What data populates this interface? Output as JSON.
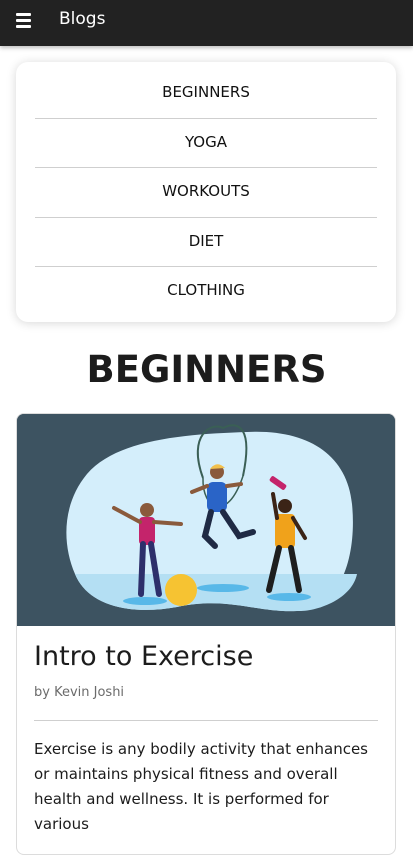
{
  "topbar": {
    "title": "Blogs",
    "menu_icon": "hamburger-menu-icon"
  },
  "categories": [
    {
      "label": "BEGINNERS"
    },
    {
      "label": "YOGA"
    },
    {
      "label": "WORKOUTS"
    },
    {
      "label": "DIET"
    },
    {
      "label": "CLOTHING"
    }
  ],
  "section": {
    "heading": "BEGINNERS"
  },
  "post": {
    "title": "Intro to Exercise",
    "author": "by Kevin Joshi",
    "excerpt": "Exercise is any bodily activity that enhances or maintains physical fitness and overall health and wellness. It is performed for various",
    "image_icon": "exercise-illustration-icon"
  },
  "colors": {
    "topbar": "#222222",
    "hero_background": "#3d5361",
    "hero_blob": "#d4eefb",
    "accent_ball": "#f6c332"
  }
}
